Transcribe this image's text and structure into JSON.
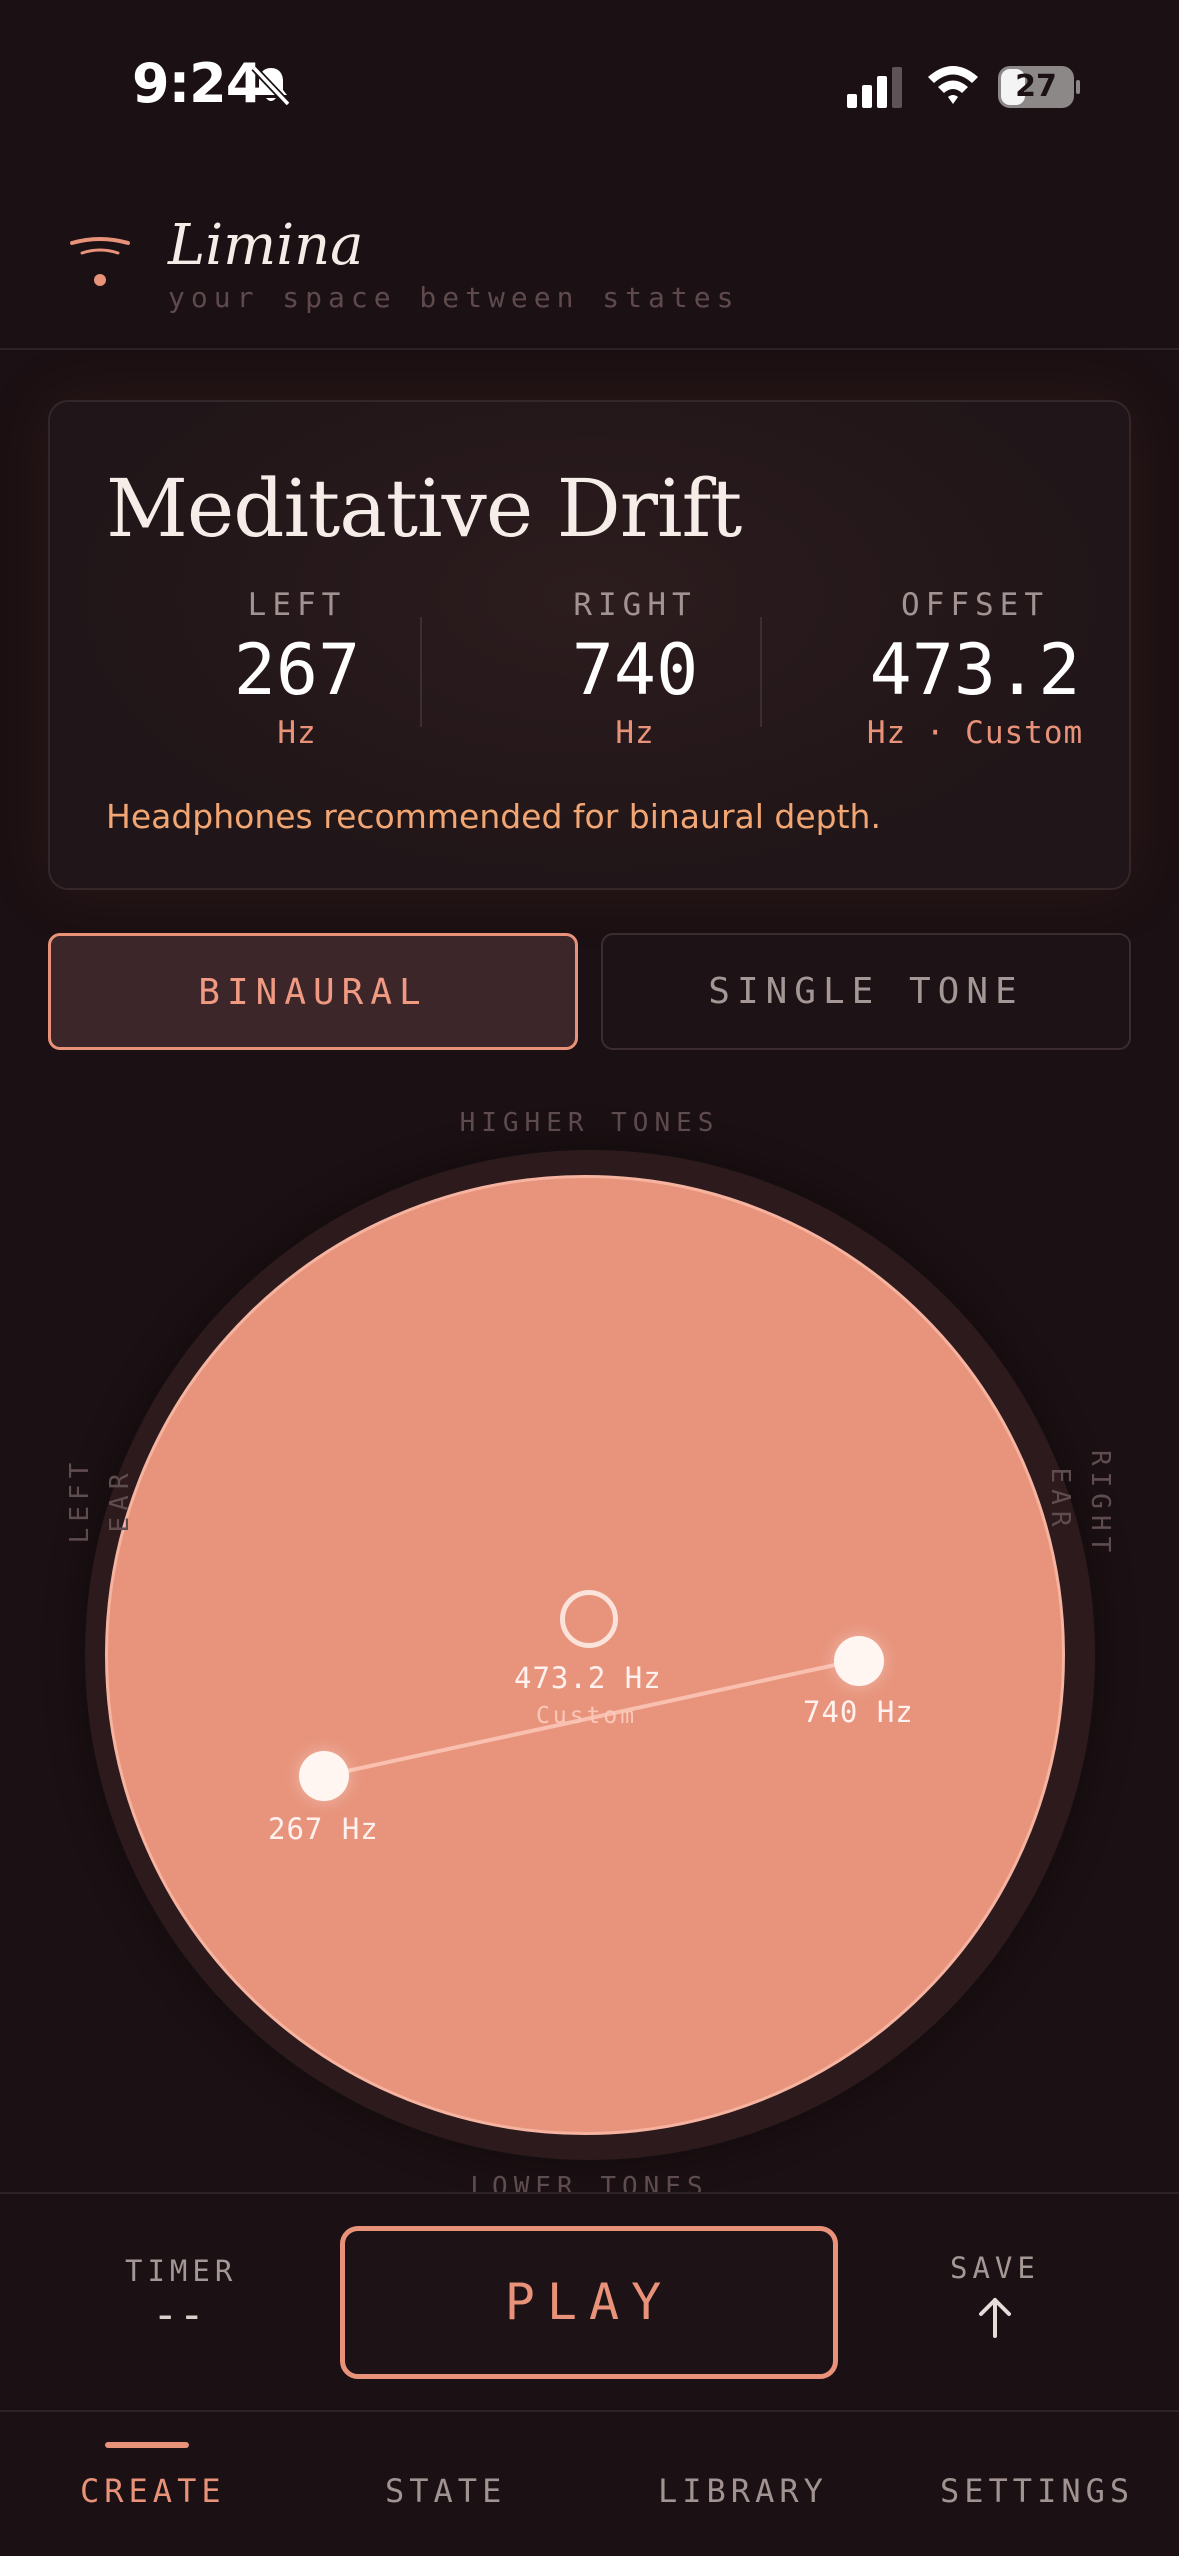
{
  "status_bar": {
    "time": "9:24",
    "battery": "27"
  },
  "app": {
    "title": "Limina",
    "subtitle": "your space between states"
  },
  "preset": {
    "name": "Meditative Drift",
    "left": {
      "label": "LEFT",
      "value": "267",
      "unit": "Hz"
    },
    "right": {
      "label": "RIGHT",
      "value": "740",
      "unit": "Hz"
    },
    "offset": {
      "label": "OFFSET",
      "value": "473.2",
      "unit": "Hz · Custom"
    },
    "note": "Headphones recommended for binaural depth."
  },
  "modes": {
    "binaural": "BINAURAL",
    "single": "SINGLE TONE",
    "selected": "BINAURAL"
  },
  "pad": {
    "top_label": "HIGHER TONES",
    "bottom_label": "LOWER TONES",
    "left_label": "LEFT EAR",
    "right_label": "RIGHT EAR",
    "left_node_label": "267 Hz",
    "right_node_label": "740 Hz",
    "center_label": "473.2 Hz",
    "center_sub": "Custom"
  },
  "controls": {
    "timer_label": "TIMER",
    "timer_value": "--",
    "play_label": "PLAY",
    "save_label": "SAVE"
  },
  "tabs": [
    {
      "label": "CREATE",
      "active": true
    },
    {
      "label": "STATE",
      "active": false
    },
    {
      "label": "LIBRARY",
      "active": false
    },
    {
      "label": "SETTINGS",
      "active": false
    }
  ],
  "colors": {
    "background": "#1b1013",
    "accent": "#e8927a",
    "pad": "#e8947c",
    "note": "#f1a673"
  },
  "icons": [
    "bell-slash-icon",
    "signal-icon",
    "wifi-icon",
    "battery-icon",
    "limina-logo-icon",
    "arrow-up-icon"
  ]
}
